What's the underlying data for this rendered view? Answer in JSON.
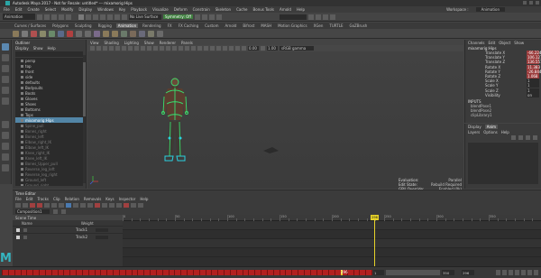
{
  "window": {
    "title": "Autodesk Maya 2017 - Not for Resale: untitled*  ---  mixamorig:Hips"
  },
  "menubar": {
    "items": [
      "File",
      "Edit",
      "Create",
      "Select",
      "Modify",
      "Display",
      "Windows",
      "Key",
      "Playback",
      "Visualize",
      "Deform",
      "Constrain",
      "Skeleton",
      "Cache",
      "Bonus Tools",
      "Arnold",
      "Help"
    ],
    "workspace_label": "Workspace :",
    "workspace_value": "Animation"
  },
  "statusline": {
    "mode": "Animation",
    "no_live": "No Live Surface",
    "chip": "Symmetry: Off"
  },
  "shelf": {
    "tabs": [
      "Curves / Surfaces",
      "Polygons",
      "Sculpting",
      "Rigging",
      "Animation",
      "Rendering",
      "FX",
      "FX Caching",
      "Custom",
      "Arnold",
      "Bifrost",
      "MASH",
      "Motion Graphics",
      "XGen",
      "TURTLE",
      "GoZBrush"
    ],
    "active_tab": "Animation"
  },
  "outliner": {
    "title": "Outliner",
    "menu": [
      "Display",
      "Show",
      "Help"
    ],
    "items": [
      {
        "label": "persp",
        "state": "normal"
      },
      {
        "label": "top",
        "state": "normal"
      },
      {
        "label": "front",
        "state": "normal"
      },
      {
        "label": "side",
        "state": "normal"
      },
      {
        "label": "defaults",
        "state": "normal"
      },
      {
        "label": "Bodysuits",
        "state": "normal"
      },
      {
        "label": "Boots",
        "state": "normal"
      },
      {
        "label": "Gloves",
        "state": "normal"
      },
      {
        "label": "Shoes",
        "state": "normal"
      },
      {
        "label": "Bottoms",
        "state": "normal"
      },
      {
        "label": "Tops",
        "state": "normal"
      },
      {
        "label": "mixamorig:Hips",
        "state": "selected"
      },
      {
        "label": "Spine_pull",
        "state": "dim"
      },
      {
        "label": "Bones_right",
        "state": "dim"
      },
      {
        "label": "Bones_left",
        "state": "dim"
      },
      {
        "label": "Elbow_right_IK",
        "state": "dim"
      },
      {
        "label": "Elbow_left_IK",
        "state": "dim"
      },
      {
        "label": "Knee_right_IK",
        "state": "dim"
      },
      {
        "label": "Knee_left_IK",
        "state": "dim"
      },
      {
        "label": "Bones_Upper_pull",
        "state": "dim"
      },
      {
        "label": "Reverse_leg_left",
        "state": "dim"
      },
      {
        "label": "Reverse_leg_right",
        "state": "dim"
      },
      {
        "label": "Ground_left",
        "state": "dim"
      },
      {
        "label": "Ground_right",
        "state": "dim"
      },
      {
        "label": "defaultLightSet",
        "state": "dim"
      },
      {
        "label": "defaultObjectSet",
        "state": "dim"
      }
    ]
  },
  "viewport": {
    "menu": [
      "View",
      "Shading",
      "Lighting",
      "Show",
      "Renderer",
      "Panels"
    ],
    "colorspace": "sRGB gamma",
    "near": "0.00",
    "far": "1.00",
    "hud": [
      {
        "label": "Evaluation:",
        "value": "Parallel"
      },
      {
        "label": "Edit State:",
        "value": "Rebuild Required"
      },
      {
        "label": "GPU Override:",
        "value": "Enabled (0k)"
      },
      {
        "label": "",
        "value": "33 fps"
      }
    ]
  },
  "channelbox": {
    "menu": [
      "Channels",
      "Edit",
      "Object",
      "Show"
    ],
    "object": "mixamorig:Hips",
    "channels": [
      {
        "label": "Translate X",
        "value": "-66.224",
        "keyed": true
      },
      {
        "label": "Translate Y",
        "value": "106.127",
        "keyed": true
      },
      {
        "label": "Translate Z",
        "value": "136.557",
        "keyed": true
      },
      {
        "label": "Rotate X",
        "value": "11.383",
        "keyed": true
      },
      {
        "label": "Rotate Y",
        "value": "-26.844",
        "keyed": true
      },
      {
        "label": "Rotate Z",
        "value": "1.068",
        "keyed": true
      },
      {
        "label": "Scale X",
        "value": "1",
        "keyed": false
      },
      {
        "label": "Scale Y",
        "value": "1",
        "keyed": false
      },
      {
        "label": "Scale Z",
        "value": "1",
        "keyed": false
      },
      {
        "label": "Visibility",
        "value": "on",
        "keyed": false
      }
    ],
    "inputs_label": "INPUTS",
    "inputs": [
      "blendPose1",
      "blendPose2",
      "clipLibrary1"
    ]
  },
  "layereditor": {
    "tabs": [
      "Display",
      "Anim"
    ],
    "active_tab": "Anim",
    "menu": [
      "Layers",
      "Options",
      "Help"
    ]
  },
  "timeeditor": {
    "title": "Time Editor",
    "menu": [
      "File",
      "Edit",
      "Tracks",
      "Clip",
      "Relation",
      "Removals",
      "Keys",
      "Inspector",
      "Help"
    ],
    "composition": "Composition1",
    "scene_label": "Scene Time",
    "col_name": "Name",
    "col_weight": "Weight",
    "tracks": [
      {
        "name": "Track1"
      },
      {
        "name": "Track2"
      }
    ],
    "ruler_labels": [
      "0",
      "50",
      "100",
      "150",
      "200",
      "250",
      "300",
      "350",
      "400"
    ],
    "current_frame": "296"
  },
  "timeslider": {
    "current": "296",
    "start": "1",
    "end": "250",
    "range_start": "1",
    "range_end": "350"
  }
}
